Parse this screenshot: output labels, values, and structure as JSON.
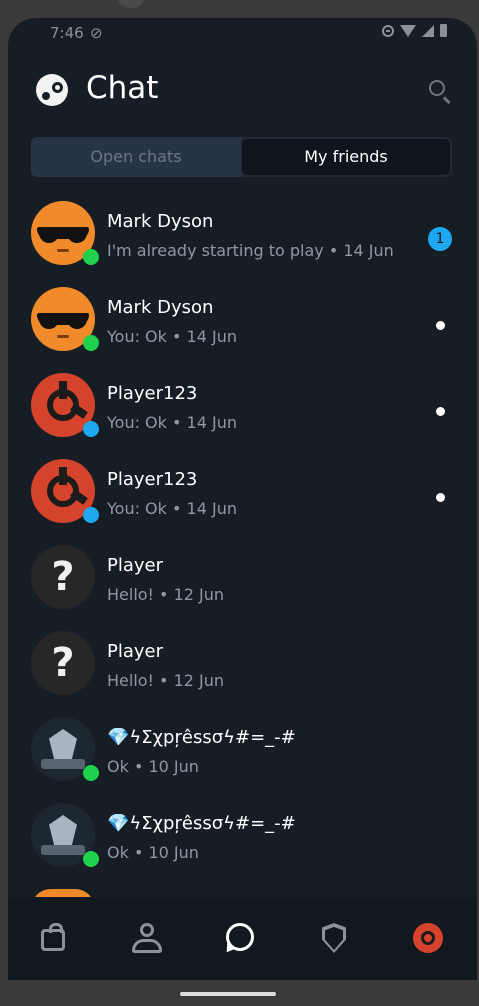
{
  "statusbar": {
    "time": "7:46"
  },
  "header": {
    "title": "Chat"
  },
  "tabs": [
    {
      "label": "Open chats",
      "active": false
    },
    {
      "label": "My friends",
      "active": true
    }
  ],
  "colors": {
    "online": "#1fd14b",
    "in_game": "#1ea8f0",
    "badge": "#1ea8f0",
    "background": "#171d25"
  },
  "chats": [
    {
      "name": "Mark Dyson",
      "preview": "I'm already starting to play • 14 Jun",
      "avatar": "sunglasses-face",
      "status": "online",
      "indicator": "badge",
      "badge_count": "1"
    },
    {
      "name": "Mark Dyson",
      "preview": "You: Ok • 14 Jun",
      "avatar": "sunglasses-face",
      "status": "online",
      "indicator": "dot"
    },
    {
      "name": "Player123",
      "preview": "You: Ok • 14 Jun",
      "avatar": "rust-logo",
      "status": "in_game",
      "indicator": "dot"
    },
    {
      "name": "Player123",
      "preview": "You: Ok • 14 Jun",
      "avatar": "rust-logo",
      "status": "in_game",
      "indicator": "dot"
    },
    {
      "name": "Player",
      "preview": "Hello! • 12 Jun",
      "avatar": "question-mark",
      "status": "none",
      "indicator": "none"
    },
    {
      "name": "Player",
      "preview": "Hello! • 12 Jun",
      "avatar": "question-mark",
      "status": "none",
      "indicator": "none"
    },
    {
      "name": "💎ϟΣχpŗêssσϟ#=_-#",
      "preview": "Ok • 10 Jun",
      "avatar": "espresso-emblem",
      "status": "online",
      "indicator": "none"
    },
    {
      "name": "💎ϟΣχpŗêssσϟ#=_-#",
      "preview": "Ok • 10 Jun",
      "avatar": "espresso-emblem",
      "status": "online",
      "indicator": "none"
    }
  ],
  "bottom_nav": [
    {
      "name": "store",
      "icon": "shopping-bag-icon",
      "active": false
    },
    {
      "name": "profile",
      "icon": "person-icon",
      "active": false
    },
    {
      "name": "chat",
      "icon": "chat-bubble-icon",
      "active": true
    },
    {
      "name": "guard",
      "icon": "shield-icon",
      "active": false
    },
    {
      "name": "account",
      "icon": "avatar-icon",
      "active": false
    }
  ]
}
